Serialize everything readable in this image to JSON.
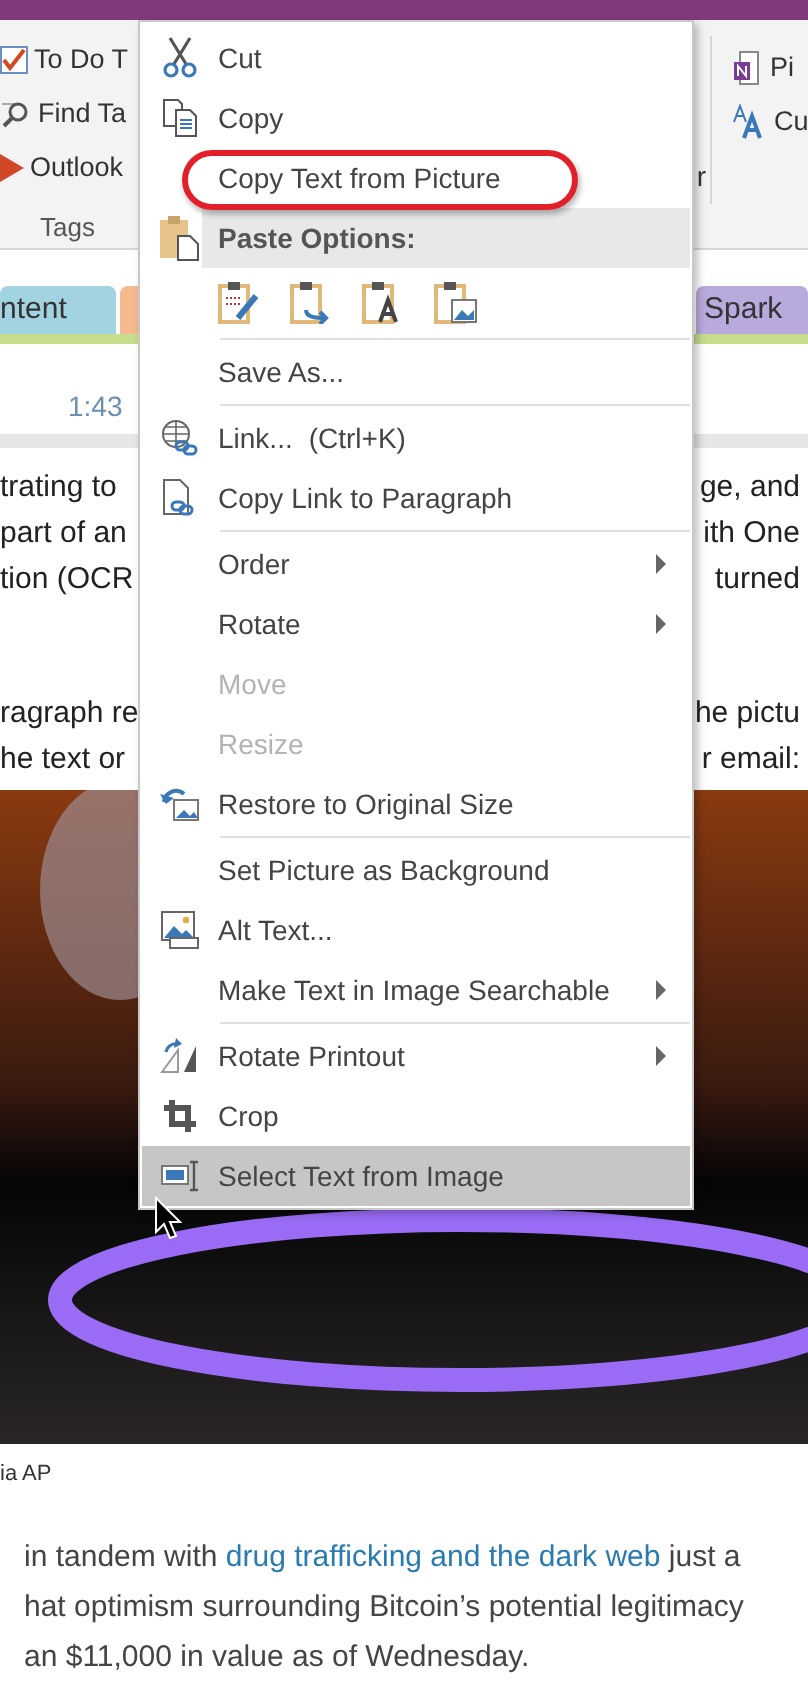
{
  "ribbon": {
    "left_items": [
      "To Do T",
      "Find Ta",
      "Outlook"
    ],
    "group_label": "Tags",
    "right_items": [
      "Pi",
      "Cu"
    ],
    "cut_text": "r"
  },
  "section_tabs": [
    {
      "label": "ntent",
      "color": "#a2d3e1"
    },
    {
      "color": "#f4b98c"
    },
    {
      "label": "Spark",
      "color": "#b9aadd"
    }
  ],
  "page": {
    "time": "1:43",
    "lines": [
      [
        "trating to",
        "ge, and"
      ],
      [
        "part of an",
        "ith One"
      ],
      [
        "tion (OCR",
        "turned"
      ],
      [
        "ragraph re",
        "he pictu"
      ],
      [
        "he text or",
        "r email:"
      ]
    ],
    "caption": "ia AP",
    "body": [
      [
        {
          "kind": "text",
          "text": "in tandem with "
        },
        {
          "kind": "link",
          "text": "drug trafficking and the dark web"
        },
        {
          "kind": "text",
          "text": " just a"
        }
      ],
      [
        {
          "kind": "text",
          "text": "hat optimism surrounding Bitcoin’s potential legitimacy"
        }
      ],
      [
        {
          "kind": "text",
          "text": "an $11,000 in value as of Wednesday."
        }
      ]
    ]
  },
  "context_menu": {
    "items": [
      {
        "kind": "item",
        "label": "Cut",
        "submenu": false,
        "disabled": false,
        "selected": false,
        "annotated": false
      },
      {
        "kind": "item",
        "label": "Copy",
        "submenu": false,
        "disabled": false,
        "selected": false,
        "annotated": false
      },
      {
        "kind": "item",
        "label": "Copy Text from Picture",
        "submenu": false,
        "disabled": false,
        "selected": false,
        "annotated": true
      },
      {
        "kind": "header",
        "label": "Paste Options:"
      },
      {
        "kind": "paste_icons"
      },
      {
        "kind": "separator"
      },
      {
        "kind": "item",
        "label": "Save As...",
        "submenu": false,
        "disabled": false,
        "selected": false,
        "annotated": false
      },
      {
        "kind": "separator"
      },
      {
        "kind": "item",
        "label": "Link...",
        "shortcut": "(Ctrl+K)",
        "submenu": false,
        "disabled": false,
        "selected": false,
        "annotated": false
      },
      {
        "kind": "item",
        "label": "Copy Link to Paragraph",
        "submenu": false,
        "disabled": false,
        "selected": false,
        "annotated": false
      },
      {
        "kind": "separator"
      },
      {
        "kind": "item",
        "label": "Order",
        "submenu": true,
        "disabled": false,
        "selected": false,
        "annotated": false
      },
      {
        "kind": "item",
        "label": "Rotate",
        "submenu": true,
        "disabled": false,
        "selected": false,
        "annotated": false
      },
      {
        "kind": "item",
        "label": "Move",
        "submenu": false,
        "disabled": true,
        "selected": false,
        "annotated": false
      },
      {
        "kind": "item",
        "label": "Resize",
        "submenu": false,
        "disabled": true,
        "selected": false,
        "annotated": false
      },
      {
        "kind": "item",
        "label": "Restore to Original Size",
        "submenu": false,
        "disabled": false,
        "selected": false,
        "annotated": false
      },
      {
        "kind": "separator"
      },
      {
        "kind": "item",
        "label": "Set Picture as Background",
        "submenu": false,
        "disabled": false,
        "selected": false,
        "annotated": false
      },
      {
        "kind": "item",
        "label": "Alt Text...",
        "submenu": false,
        "disabled": false,
        "selected": false,
        "annotated": false
      },
      {
        "kind": "item",
        "label": "Make Text in Image Searchable",
        "submenu": true,
        "disabled": false,
        "selected": false,
        "annotated": false
      },
      {
        "kind": "separator"
      },
      {
        "kind": "item",
        "label": "Rotate Printout",
        "submenu": true,
        "disabled": false,
        "selected": false,
        "annotated": false
      },
      {
        "kind": "item",
        "label": "Crop",
        "submenu": false,
        "disabled": false,
        "selected": false,
        "annotated": false
      },
      {
        "kind": "item",
        "label": "Select Text from Image",
        "submenu": false,
        "disabled": false,
        "selected": true,
        "annotated": false
      }
    ]
  }
}
